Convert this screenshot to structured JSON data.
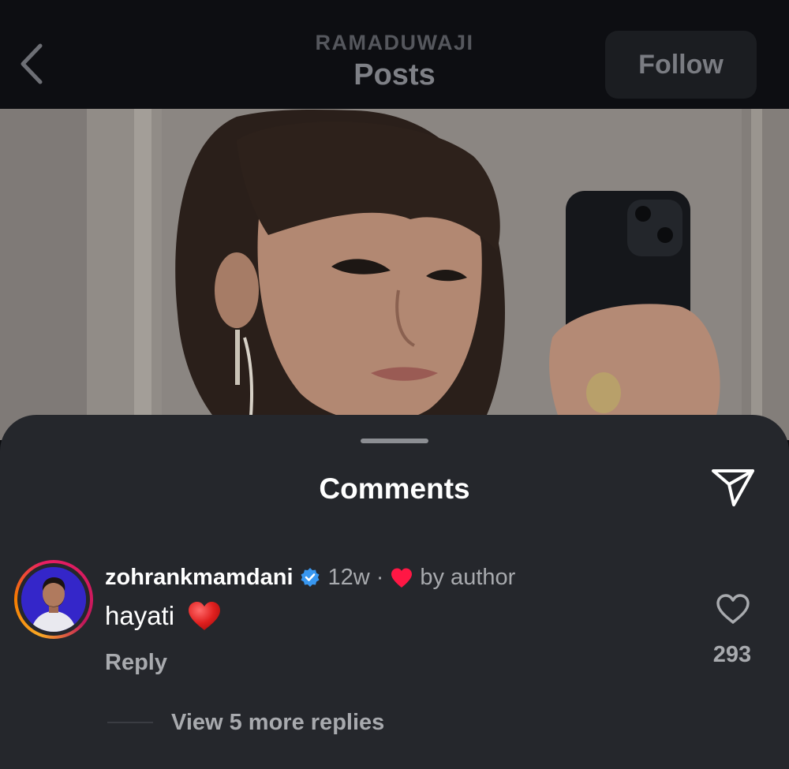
{
  "header": {
    "subtitle": "RAMADUWAJI",
    "title": "Posts",
    "follow_label": "Follow"
  },
  "comments_sheet": {
    "title": "Comments",
    "comment": {
      "username": "zohrankmamdani",
      "verified": true,
      "time": "12w",
      "separator": "·",
      "liked_by_author": "by author",
      "text": "hayati",
      "reply_label": "Reply",
      "like_count": "293",
      "view_replies_label": "View 5 more replies"
    }
  },
  "colors": {
    "background": "#25272c",
    "header": "#0d0e12",
    "heart_red": "#ff1744",
    "verified_blue": "#3897f0"
  },
  "icons": [
    "back-chevron-icon",
    "share-send-icon",
    "verified-badge-icon",
    "heart-liked-icon",
    "heart-emoji-icon",
    "heart-outline-icon"
  ]
}
